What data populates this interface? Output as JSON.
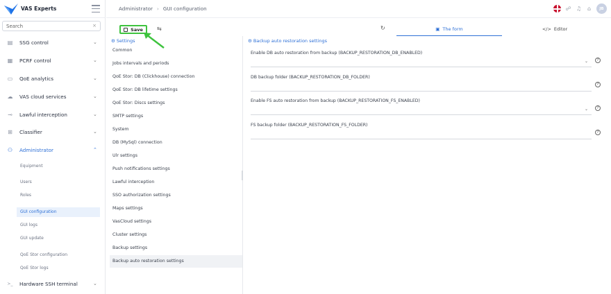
{
  "brand": {
    "name": "VAS Experts"
  },
  "search": {
    "placeholder": "Search",
    "clear": "×"
  },
  "nav": [
    {
      "label": "SSG control",
      "icon": "grid-icon",
      "glyph": "▤",
      "chevron": "⌄",
      "active": false
    },
    {
      "label": "PCRF control",
      "icon": "pcrf-icon",
      "glyph": "▦",
      "chevron": "⌄",
      "active": false
    },
    {
      "label": "QoE analytics",
      "icon": "chart-icon",
      "glyph": "▭",
      "chevron": "⌄",
      "active": false
    },
    {
      "label": "VAS cloud services",
      "icon": "cloud-icon",
      "glyph": "☁",
      "chevron": "⌄",
      "active": false
    },
    {
      "label": "Lawful interception",
      "icon": "interception-icon",
      "glyph": "⊸",
      "chevron": "⌄",
      "active": false
    },
    {
      "label": "Classifier",
      "icon": "tree-icon",
      "glyph": "⊞",
      "chevron": "⌄",
      "active": false
    },
    {
      "label": "Administrator",
      "icon": "users-icon",
      "glyph": "⚇",
      "chevron": "⌃",
      "active": true
    }
  ],
  "admin_sub": [
    {
      "label": "Equipment",
      "active": false
    },
    {
      "label": "Users",
      "active": false
    },
    {
      "label": "Roles",
      "active": false
    },
    {
      "label": "GUI configuration",
      "active": true
    },
    {
      "label": "GUI logs",
      "active": false
    },
    {
      "label": "GUI update",
      "active": false
    },
    {
      "label": "QoE Stor configuration",
      "active": false
    },
    {
      "label": "QoE Stor logs",
      "active": false
    }
  ],
  "nav_bottom": {
    "label": "Hardware SSH terminal",
    "icon": "terminal-icon",
    "glyph": "≻_",
    "chevron": "⌄"
  },
  "breadcrumb": {
    "root": "Administrator",
    "sep": "›",
    "current": "GUI configuration"
  },
  "header": {
    "avatar": "JB"
  },
  "toolbar": {
    "save_label": "Save",
    "swap_glyph": "⇆",
    "refresh_glyph": "↻"
  },
  "tabs": [
    {
      "label": "The form",
      "glyph": "▣",
      "active": true
    },
    {
      "label": "Editor",
      "glyph": "</>",
      "active": false
    }
  ],
  "settings": {
    "title": "Settings",
    "items": [
      "Common",
      "Jobs intervals and periods",
      "QoE Stor: DB (Clickhouse) connection",
      "QoE Stor: DB lifetime settings",
      "QoE Stor: Discs settings",
      "SMTP settings",
      "System",
      "DB (MySql) connection",
      "Ulr settings",
      "Push notifications settings",
      "Lawful interception",
      "SSO authorization settings",
      "Maps settings",
      "VasCloud settings",
      "Cluster settings",
      "Backup settings",
      "Backup auto restoration settings"
    ],
    "active_index": 16
  },
  "form": {
    "title": "Backup auto restoration settings",
    "fields": [
      {
        "label": "Enable DB auto restoration from backup (BACKUP_RESTORATION_DB_ENABLED)",
        "type": "select"
      },
      {
        "label": "DB backup folder (BACKUP_RESTORATION_DB_FOLDER)",
        "type": "text"
      },
      {
        "label": "Enable FS auto restoration from backup (BACKUP_RESTORATION_FS_ENABLED)",
        "type": "select"
      },
      {
        "label": "FS backup folder (BACKUP_RESTORATION_FS_FOLDER)",
        "type": "text"
      }
    ],
    "help_glyph": "?"
  },
  "colors": {
    "accent": "#2d6fd6",
    "highlight": "#3ec33e",
    "brand": "#1e73e8"
  }
}
